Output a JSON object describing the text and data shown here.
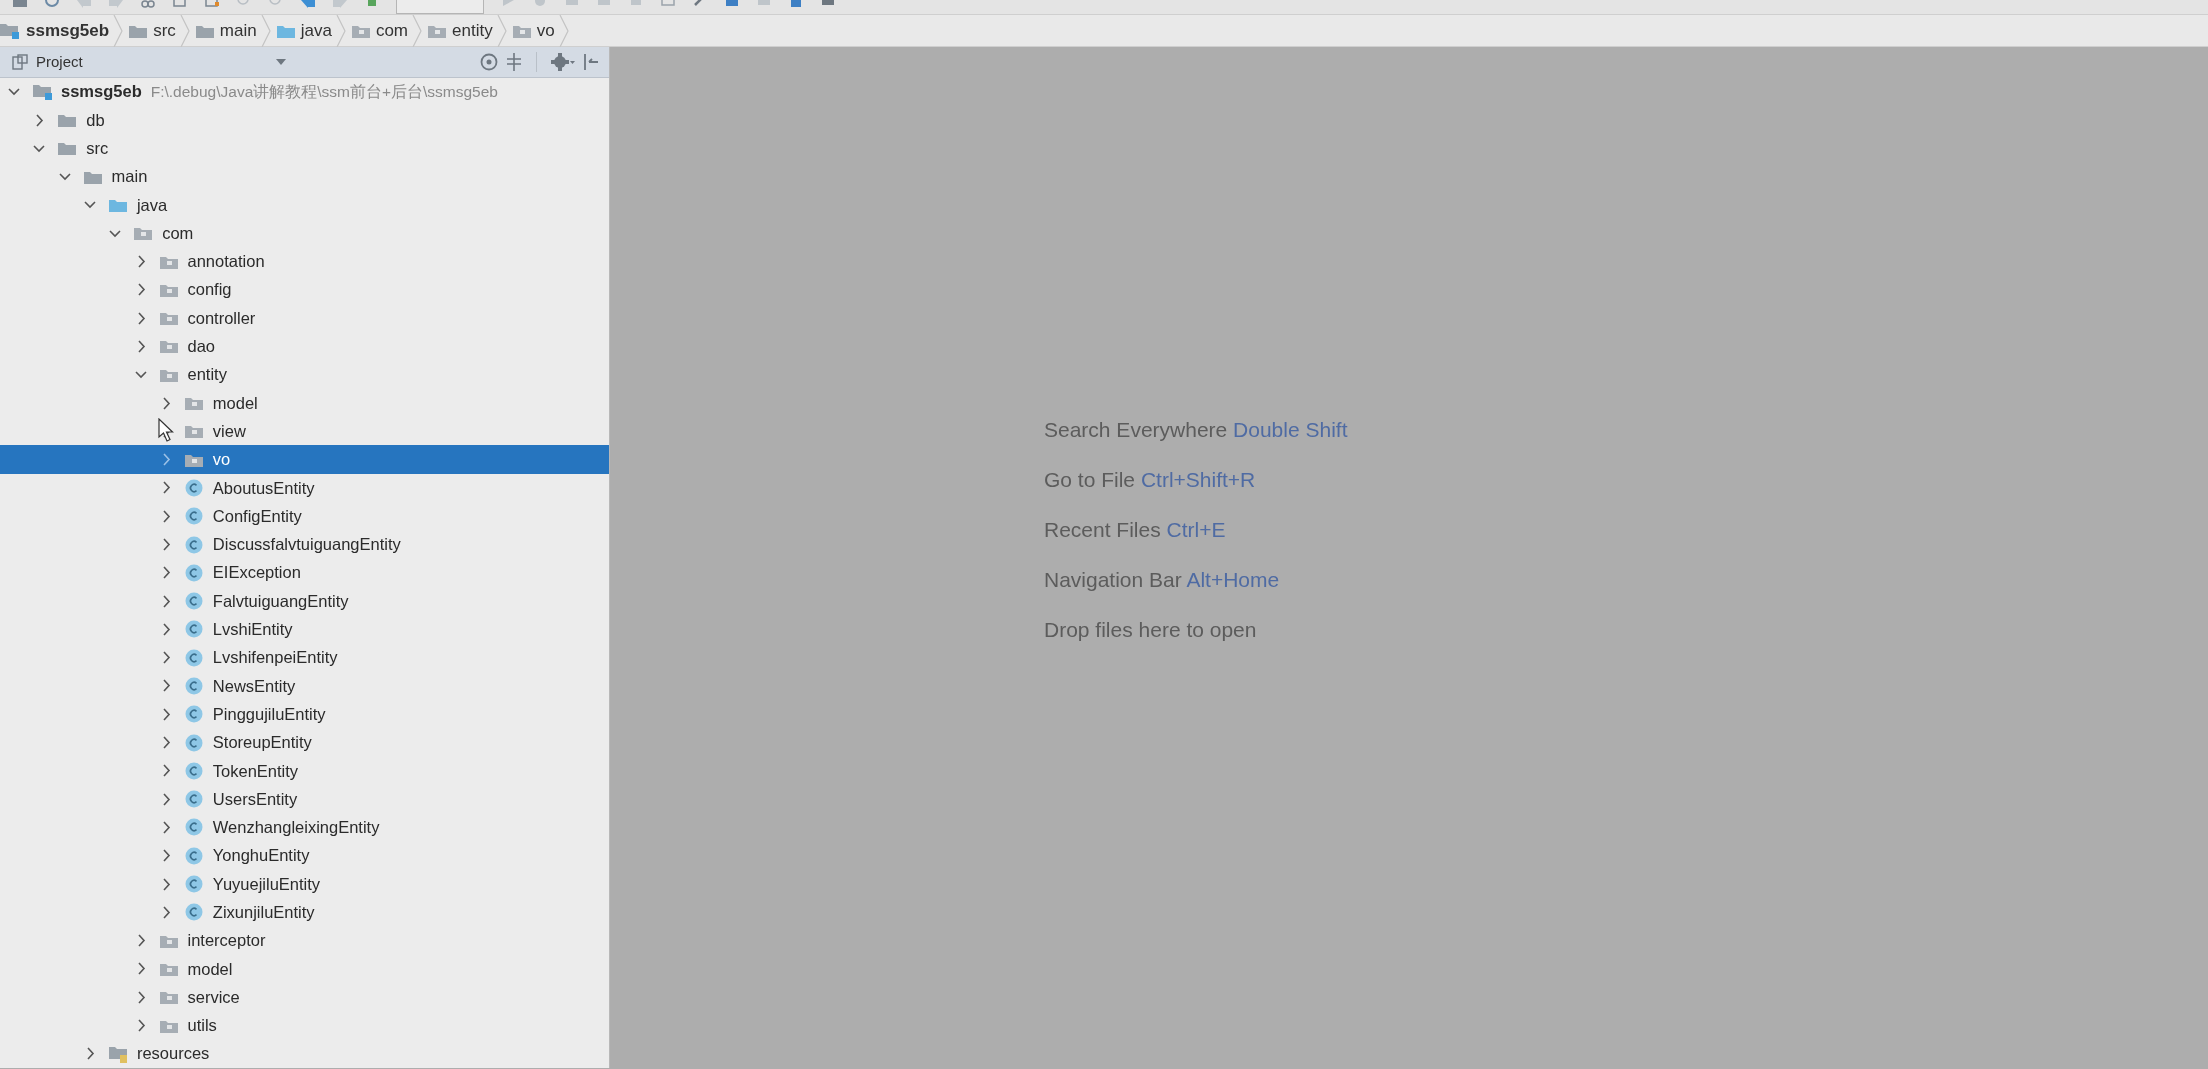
{
  "breadcrumb": [
    {
      "label": "ssmsg5eb",
      "kind": "module"
    },
    {
      "label": "src",
      "kind": "folder"
    },
    {
      "label": "main",
      "kind": "folder"
    },
    {
      "label": "java",
      "kind": "source"
    },
    {
      "label": "com",
      "kind": "package"
    },
    {
      "label": "entity",
      "kind": "package"
    },
    {
      "label": "vo",
      "kind": "package"
    }
  ],
  "project_panel": {
    "title": "Project"
  },
  "tree": [
    {
      "name": "ssmsg5eb",
      "path": "F:\\.debug\\Java讲解教程\\ssm前台+后台\\ssmsg5eb",
      "kind": "module",
      "expanded": true,
      "selected": false,
      "children": [
        {
          "name": "db",
          "kind": "folder",
          "expanded": false,
          "selected": false
        },
        {
          "name": "src",
          "kind": "folder",
          "expanded": true,
          "selected": false,
          "children": [
            {
              "name": "main",
              "kind": "folder",
              "expanded": true,
              "selected": false,
              "children": [
                {
                  "name": "java",
                  "kind": "source",
                  "expanded": true,
                  "selected": false,
                  "children": [
                    {
                      "name": "com",
                      "kind": "package",
                      "expanded": true,
                      "selected": false,
                      "children": [
                        {
                          "name": "annotation",
                          "kind": "package",
                          "expanded": false,
                          "selected": false
                        },
                        {
                          "name": "config",
                          "kind": "package",
                          "expanded": false,
                          "selected": false
                        },
                        {
                          "name": "controller",
                          "kind": "package",
                          "expanded": false,
                          "selected": false
                        },
                        {
                          "name": "dao",
                          "kind": "package",
                          "expanded": false,
                          "selected": false
                        },
                        {
                          "name": "entity",
                          "kind": "package",
                          "expanded": true,
                          "selected": false,
                          "children": [
                            {
                              "name": "model",
                              "kind": "package",
                              "expanded": false,
                              "selected": false
                            },
                            {
                              "name": "view",
                              "kind": "package",
                              "expanded": false,
                              "selected": false
                            },
                            {
                              "name": "vo",
                              "kind": "package",
                              "expanded": false,
                              "selected": true
                            },
                            {
                              "name": "AboutusEntity",
                              "kind": "class",
                              "expanded": false,
                              "selected": false
                            },
                            {
                              "name": "ConfigEntity",
                              "kind": "class",
                              "expanded": false,
                              "selected": false
                            },
                            {
                              "name": "DiscussfalvtuiguangEntity",
                              "kind": "class",
                              "expanded": false,
                              "selected": false
                            },
                            {
                              "name": "EIException",
                              "kind": "class",
                              "expanded": false,
                              "selected": false
                            },
                            {
                              "name": "FalvtuiguangEntity",
                              "kind": "class",
                              "expanded": false,
                              "selected": false
                            },
                            {
                              "name": "LvshiEntity",
                              "kind": "class",
                              "expanded": false,
                              "selected": false
                            },
                            {
                              "name": "LvshifenpeiEntity",
                              "kind": "class",
                              "expanded": false,
                              "selected": false
                            },
                            {
                              "name": "NewsEntity",
                              "kind": "class",
                              "expanded": false,
                              "selected": false
                            },
                            {
                              "name": "PinggujiluEntity",
                              "kind": "class",
                              "expanded": false,
                              "selected": false
                            },
                            {
                              "name": "StoreupEntity",
                              "kind": "class",
                              "expanded": false,
                              "selected": false
                            },
                            {
                              "name": "TokenEntity",
                              "kind": "class",
                              "expanded": false,
                              "selected": false
                            },
                            {
                              "name": "UsersEntity",
                              "kind": "class",
                              "expanded": false,
                              "selected": false
                            },
                            {
                              "name": "WenzhangleixingEntity",
                              "kind": "class",
                              "expanded": false,
                              "selected": false
                            },
                            {
                              "name": "YonghuEntity",
                              "kind": "class",
                              "expanded": false,
                              "selected": false
                            },
                            {
                              "name": "YuyuejiluEntity",
                              "kind": "class",
                              "expanded": false,
                              "selected": false
                            },
                            {
                              "name": "ZixunjiluEntity",
                              "kind": "class",
                              "expanded": false,
                              "selected": false
                            }
                          ]
                        },
                        {
                          "name": "interceptor",
                          "kind": "package",
                          "expanded": false,
                          "selected": false
                        },
                        {
                          "name": "model",
                          "kind": "package",
                          "expanded": false,
                          "selected": false
                        },
                        {
                          "name": "service",
                          "kind": "package",
                          "expanded": false,
                          "selected": false
                        },
                        {
                          "name": "utils",
                          "kind": "package",
                          "expanded": false,
                          "selected": false
                        }
                      ]
                    }
                  ]
                },
                {
                  "name": "resources",
                  "kind": "resources",
                  "expanded": false,
                  "selected": false
                }
              ]
            }
          ]
        }
      ]
    }
  ],
  "editor_hints": [
    {
      "text": "Search Everywhere",
      "shortcut": "Double Shift"
    },
    {
      "text": "Go to File",
      "shortcut": "Ctrl+Shift+R"
    },
    {
      "text": "Recent Files",
      "shortcut": "Ctrl+E"
    },
    {
      "text": "Navigation Bar",
      "shortcut": "Alt+Home"
    },
    {
      "text": "Drop files here to open"
    }
  ]
}
